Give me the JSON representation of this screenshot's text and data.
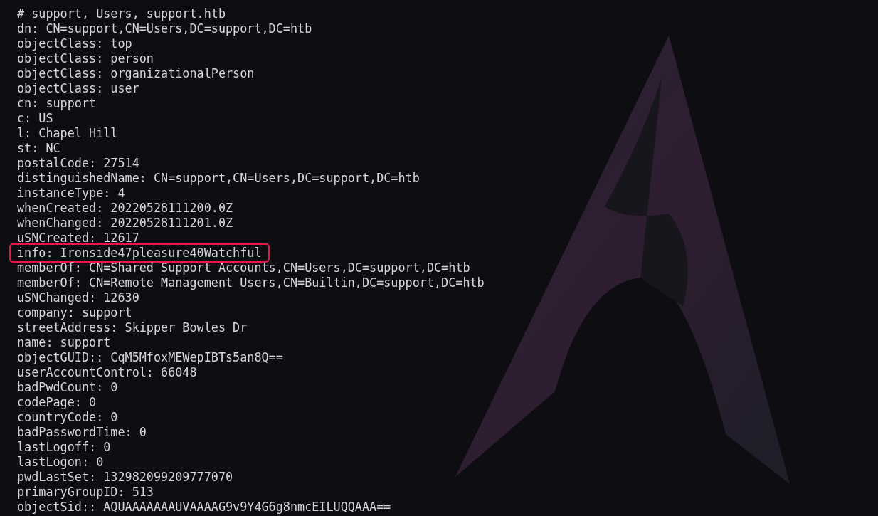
{
  "terminal": {
    "lines": [
      {
        "text": "# support, Users, support.htb",
        "highlighted": false
      },
      {
        "text": "dn: CN=support,CN=Users,DC=support,DC=htb",
        "highlighted": false
      },
      {
        "text": "objectClass: top",
        "highlighted": false
      },
      {
        "text": "objectClass: person",
        "highlighted": false
      },
      {
        "text": "objectClass: organizationalPerson",
        "highlighted": false
      },
      {
        "text": "objectClass: user",
        "highlighted": false
      },
      {
        "text": "cn: support",
        "highlighted": false
      },
      {
        "text": "c: US",
        "highlighted": false
      },
      {
        "text": "l: Chapel Hill",
        "highlighted": false
      },
      {
        "text": "st: NC",
        "highlighted": false
      },
      {
        "text": "postalCode: 27514",
        "highlighted": false
      },
      {
        "text": "distinguishedName: CN=support,CN=Users,DC=support,DC=htb",
        "highlighted": false
      },
      {
        "text": "instanceType: 4",
        "highlighted": false
      },
      {
        "text": "whenCreated: 20220528111200.0Z",
        "highlighted": false
      },
      {
        "text": "whenChanged: 20220528111201.0Z",
        "highlighted": false
      },
      {
        "text": "uSNCreated: 12617",
        "highlighted": false
      },
      {
        "text": "info: Ironside47pleasure40Watchful",
        "highlighted": true
      },
      {
        "text": "memberOf: CN=Shared Support Accounts,CN=Users,DC=support,DC=htb",
        "highlighted": false
      },
      {
        "text": "memberOf: CN=Remote Management Users,CN=Builtin,DC=support,DC=htb",
        "highlighted": false
      },
      {
        "text": "uSNChanged: 12630",
        "highlighted": false
      },
      {
        "text": "company: support",
        "highlighted": false
      },
      {
        "text": "streetAddress: Skipper Bowles Dr",
        "highlighted": false
      },
      {
        "text": "name: support",
        "highlighted": false
      },
      {
        "text": "objectGUID:: CqM5MfoxMEWepIBTs5an8Q==",
        "highlighted": false
      },
      {
        "text": "userAccountControl: 66048",
        "highlighted": false
      },
      {
        "text": "badPwdCount: 0",
        "highlighted": false
      },
      {
        "text": "codePage: 0",
        "highlighted": false
      },
      {
        "text": "countryCode: 0",
        "highlighted": false
      },
      {
        "text": "badPasswordTime: 0",
        "highlighted": false
      },
      {
        "text": "lastLogoff: 0",
        "highlighted": false
      },
      {
        "text": "lastLogon: 0",
        "highlighted": false
      },
      {
        "text": "pwdLastSet: 132982099209777070",
        "highlighted": false
      },
      {
        "text": "primaryGroupID: 513",
        "highlighted": false
      },
      {
        "text": "objectSid:: AQUAAAAAAAUVAAAAG9v9Y4G6g8nmcEILUQQAAA==",
        "highlighted": false
      }
    ]
  }
}
